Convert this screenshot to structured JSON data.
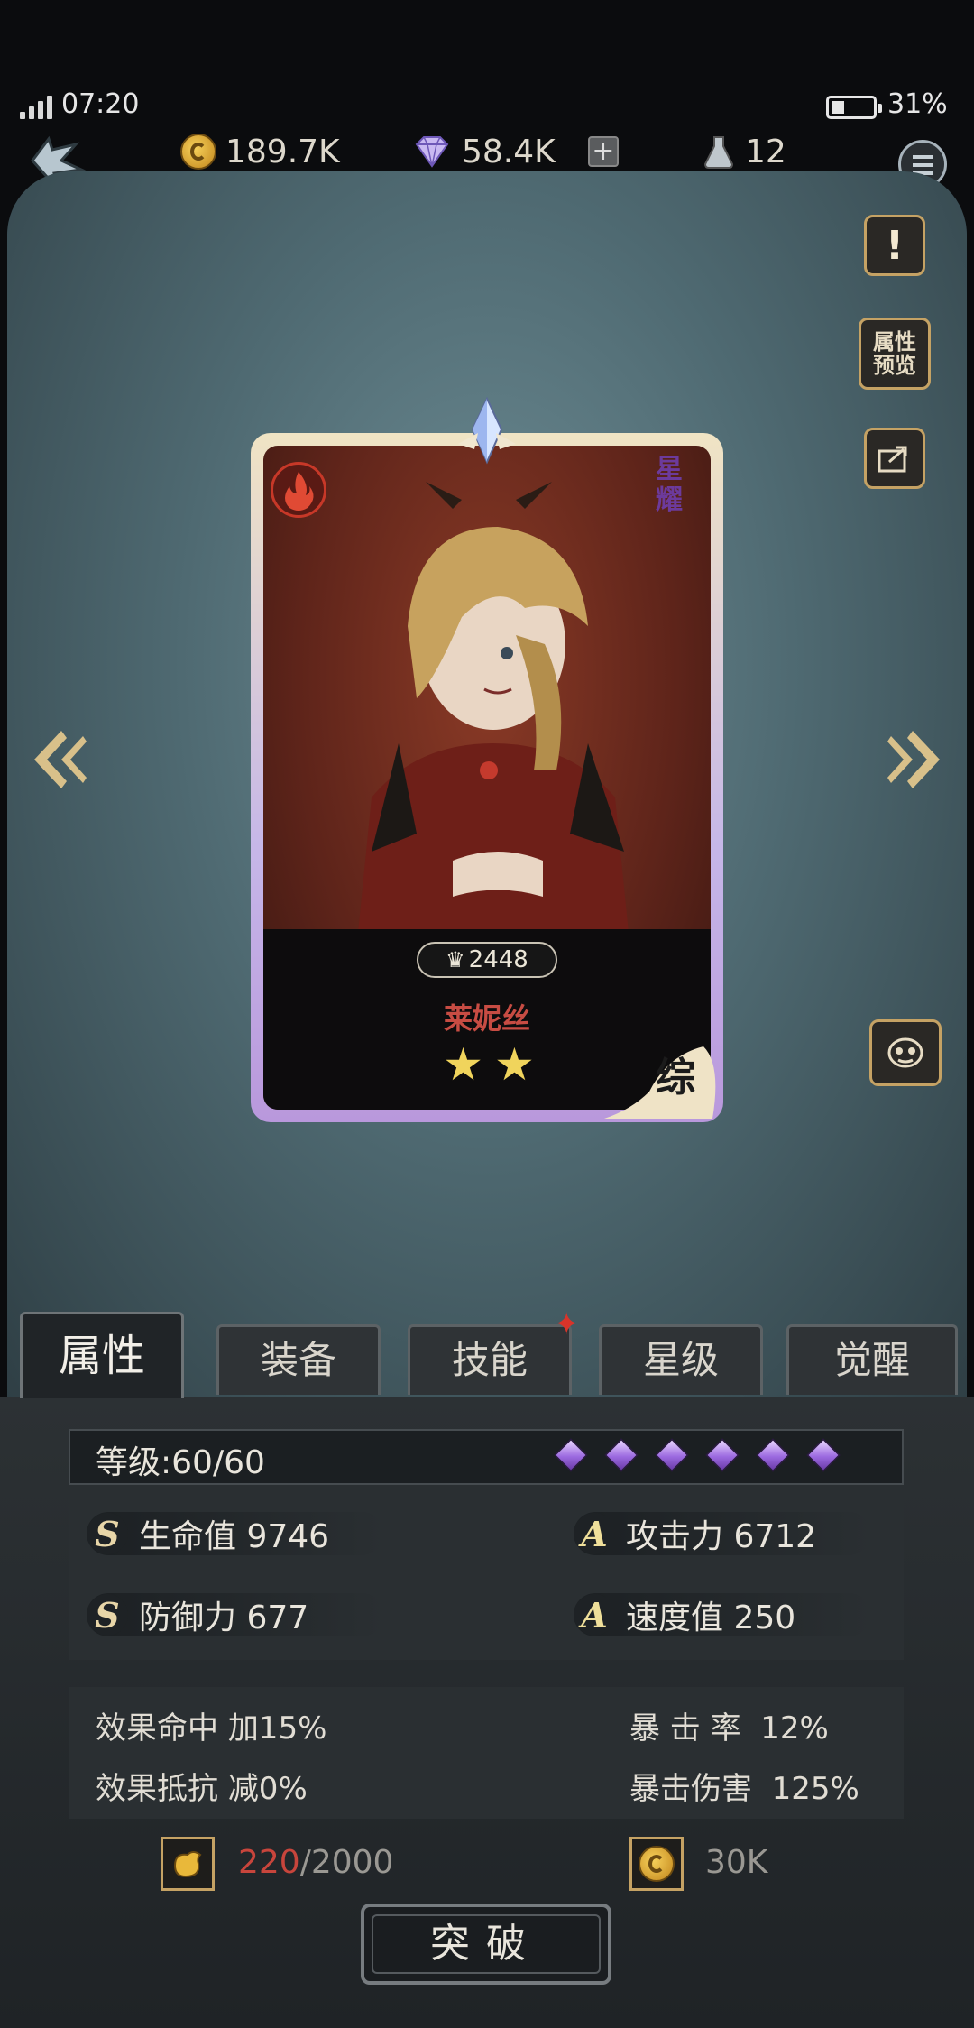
{
  "status_bar": {
    "time": "07:20",
    "battery": "31%"
  },
  "currency": {
    "gold": "189.7K",
    "diamonds": "58.4K",
    "potion": "12"
  },
  "side_buttons": {
    "attr_preview": "属性预览"
  },
  "card": {
    "power": "2448",
    "name": "莱妮丝",
    "rank": "星耀",
    "class_label": "综",
    "stars": 2
  },
  "tabs": [
    {
      "label": "属性",
      "active": true
    },
    {
      "label": "装备"
    },
    {
      "label": "技能",
      "notify": true
    },
    {
      "label": "星级"
    },
    {
      "label": "觉醒"
    }
  ],
  "level": {
    "label": "等级:60/60",
    "diamonds": 6
  },
  "stats": [
    {
      "grade": "S",
      "label": "生命值 9746"
    },
    {
      "grade": "A",
      "label": "攻击力 6712"
    },
    {
      "grade": "S",
      "label": "防御力 677"
    },
    {
      "grade": "A",
      "label": "速度值 250"
    }
  ],
  "extras": {
    "hit_label": "效果命中",
    "hit_value": "加15%",
    "resist_label": "效果抵抗",
    "resist_value": "减0%",
    "crit_rate_label": "暴 击 率",
    "crit_rate_value": "12%",
    "crit_dmg_label": "暴击伤害",
    "crit_dmg_value": "125%"
  },
  "cost": {
    "material_current": "220",
    "material_total": "/2000",
    "gold": "30K"
  },
  "break_button": "突破",
  "colors": {
    "accent_gold": "#c5a264",
    "panel": "#4f6a72",
    "red": "#c8453c"
  }
}
